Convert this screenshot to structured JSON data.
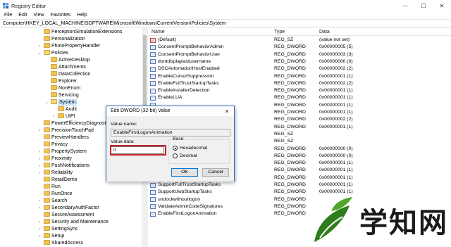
{
  "window": {
    "title": "Registry Editor",
    "controls": {
      "minimize": "—",
      "maximize": "☐",
      "close": "✕"
    }
  },
  "menu": [
    "File",
    "Edit",
    "View",
    "Favorites",
    "Help"
  ],
  "address": "Computer\\HKEY_LOCAL_MACHINE\\SOFTWARE\\Microsoft\\Windows\\CurrentVersion\\Policies\\System",
  "tree": {
    "items": [
      {
        "label": "PerceptionSimulationExtensions",
        "indent": 0,
        "expander": ""
      },
      {
        "label": "Personalization",
        "indent": 0,
        "expander": ""
      },
      {
        "label": "PhotoPropertyHandler",
        "indent": 0,
        "expander": "›"
      },
      {
        "label": "Policies",
        "indent": 0,
        "expander": "⌄",
        "open": true
      },
      {
        "label": "ActiveDesktop",
        "indent": 1,
        "expander": ""
      },
      {
        "label": "Attachments",
        "indent": 1,
        "expander": ""
      },
      {
        "label": "DataCollection",
        "indent": 1,
        "expander": ""
      },
      {
        "label": "Explorer",
        "indent": 1,
        "expander": ""
      },
      {
        "label": "NonEnum",
        "indent": 1,
        "expander": ""
      },
      {
        "label": "Servicing",
        "indent": 1,
        "expander": ""
      },
      {
        "label": "System",
        "indent": 1,
        "expander": "⌄",
        "open": true,
        "selected": true
      },
      {
        "label": "Audit",
        "indent": 2,
        "expander": ""
      },
      {
        "label": "UIPI",
        "indent": 2,
        "expander": "›"
      },
      {
        "label": "PowerEfficiencyDiagnostic",
        "indent": 0,
        "expander": ""
      },
      {
        "label": "PrecisionTouchPad",
        "indent": 0,
        "expander": "›"
      },
      {
        "label": "PreviewHandlers",
        "indent": 0,
        "expander": ""
      },
      {
        "label": "Privacy",
        "indent": 0,
        "expander": ""
      },
      {
        "label": "PropertySystem",
        "indent": 0,
        "expander": "›"
      },
      {
        "label": "Proximity",
        "indent": 0,
        "expander": "›"
      },
      {
        "label": "PushNotifications",
        "indent": 0,
        "expander": "›"
      },
      {
        "label": "Reliability",
        "indent": 0,
        "expander": "›"
      },
      {
        "label": "RetailDemo",
        "indent": 0,
        "expander": ""
      },
      {
        "label": "Run",
        "indent": 0,
        "expander": ""
      },
      {
        "label": "RunOnce",
        "indent": 0,
        "expander": ""
      },
      {
        "label": "Search",
        "indent": 0,
        "expander": "›"
      },
      {
        "label": "SecondaryAuthFactor",
        "indent": 0,
        "expander": "›"
      },
      {
        "label": "SecureAssessment",
        "indent": 0,
        "expander": ""
      },
      {
        "label": "Security and Maintenance",
        "indent": 0,
        "expander": "›"
      },
      {
        "label": "SettingSync",
        "indent": 0,
        "expander": "›"
      },
      {
        "label": "Setup",
        "indent": 0,
        "expander": "›"
      },
      {
        "label": "SharedAccess",
        "indent": 0,
        "expander": ""
      },
      {
        "label": "SharedDLLs",
        "indent": 0,
        "expander": ""
      }
    ]
  },
  "list": {
    "headers": {
      "name": "Name",
      "type": "Type",
      "data": "Data"
    },
    "rows": [
      {
        "name": "(Default)",
        "type": "REG_SZ",
        "data": "(value not set)",
        "kind": "sz"
      },
      {
        "name": "ConsentPromptBehaviorAdmin",
        "type": "REG_DWORD",
        "data": "0x00000005 (5)",
        "kind": "dword"
      },
      {
        "name": "ConsentPromptBehaviorUser",
        "type": "REG_DWORD",
        "data": "0x00000003 (3)",
        "kind": "dword"
      },
      {
        "name": "dontdisplaylastusername",
        "type": "REG_DWORD",
        "data": "0x00000000 (0)",
        "kind": "dword"
      },
      {
        "name": "DSCAutomationHostEnabled",
        "type": "REG_DWORD",
        "data": "0x00000002 (2)",
        "kind": "dword"
      },
      {
        "name": "EnableCursorSuppression",
        "type": "REG_DWORD",
        "data": "0x00000001 (1)",
        "kind": "dword"
      },
      {
        "name": "EnableFullTrustStartupTasks",
        "type": "REG_DWORD",
        "data": "0x00000002 (2)",
        "kind": "dword"
      },
      {
        "name": "EnableInstallerDetection",
        "type": "REG_DWORD",
        "data": "0x00000001 (1)",
        "kind": "dword"
      },
      {
        "name": "EnableLUA",
        "type": "REG_DWORD",
        "data": "0x00000001 (1)",
        "kind": "dword"
      },
      {
        "name": "",
        "type": "REG_DWORD",
        "data": "0x00000001 (1)",
        "kind": "dword"
      },
      {
        "name": "",
        "type": "REG_DWORD",
        "data": "0x00000001 (1)",
        "kind": "dword"
      },
      {
        "name": "",
        "type": "REG_DWORD",
        "data": "0x00000002 (2)",
        "kind": "dword"
      },
      {
        "name": "",
        "type": "REG_DWORD",
        "data": "0x00000001 (1)",
        "kind": "dword"
      },
      {
        "name": "",
        "type": "REG_SZ",
        "data": "",
        "kind": "sz"
      },
      {
        "name": "",
        "type": "REG_SZ",
        "data": "",
        "kind": "sz"
      },
      {
        "name": "",
        "type": "REG_DWORD",
        "data": "0x00000000 (0)",
        "kind": "dword"
      },
      {
        "name": "",
        "type": "REG_DWORD",
        "data": "0x00000000 (0)",
        "kind": "dword"
      },
      {
        "name": "",
        "type": "REG_DWORD",
        "data": "0x00000001 (1)",
        "kind": "dword"
      },
      {
        "name": "",
        "type": "REG_DWORD",
        "data": "0x00000001 (1)",
        "kind": "dword"
      },
      {
        "name": "",
        "type": "REG_DWORD",
        "data": "0x00000001 (1)",
        "kind": "dword"
      },
      {
        "name": "SupportFullTrustStartupTasks",
        "type": "REG_DWORD",
        "data": "0x00000001 (1)",
        "kind": "dword"
      },
      {
        "name": "SupportUwpStartupTasks",
        "type": "REG_DWORD",
        "data": "0x00000001 (1)",
        "kind": "dword"
      },
      {
        "name": "undockwithoutlogon",
        "type": "REG_DWORD",
        "data": "",
        "kind": "dword"
      },
      {
        "name": "ValidateAdminCodeSignatures",
        "type": "REG_DWORD",
        "data": "",
        "kind": "dword"
      },
      {
        "name": "EnableFirstLogonAnimation",
        "type": "REG_DWORD",
        "data": "",
        "kind": "dword"
      }
    ]
  },
  "dialog": {
    "title": "Edit DWORD (32-bit) Value",
    "close": "✕",
    "value_name_label": "Value name:",
    "value_name": "EnableFirstLogonAnimation",
    "value_data_label": "Value data:",
    "value_data": "0",
    "base_label": "Base",
    "hex_label": "Hexadecimal",
    "dec_label": "Decimal",
    "ok": "OK",
    "cancel": "Cancel"
  },
  "watermark": {
    "text": "学知网"
  },
  "colors": {
    "selection": "#cce8ff",
    "highlight_box": "#c8202a",
    "dialog_border": "#2a67b4",
    "logo_green": "#2e7d1a"
  }
}
